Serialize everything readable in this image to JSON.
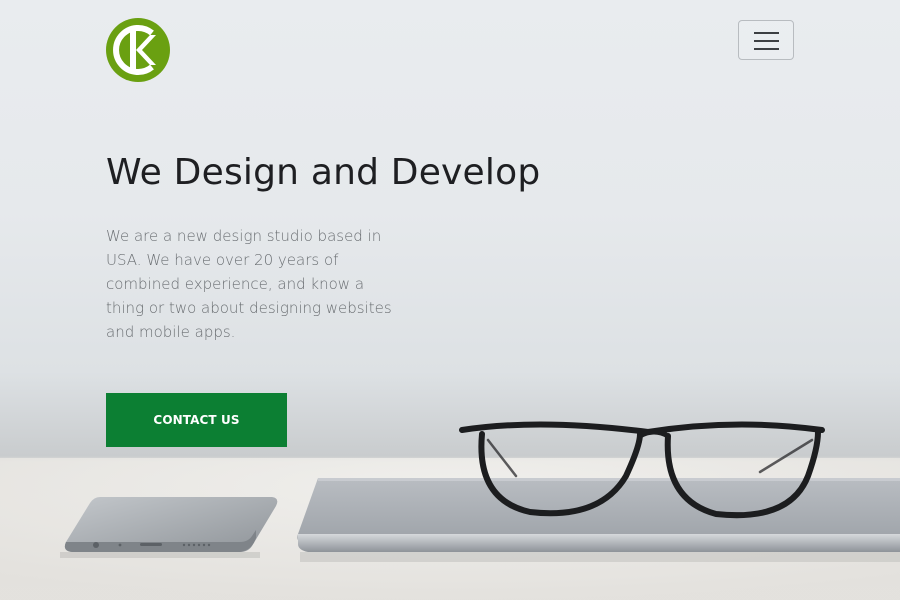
{
  "header": {
    "logo_text": "CK",
    "menu_icon": "hamburger-icon"
  },
  "hero": {
    "title": "We Design and Develop",
    "description": "We are a new design studio based in USA. We have over 20 years of combined experience, and know a thing or two about designing websites and mobile apps.",
    "cta_label": "CONTACT US"
  },
  "colors": {
    "brand_green": "#6aa011",
    "cta_green": "#0c7f33",
    "heading": "#1e1f22",
    "body_text": "#6b6f73"
  }
}
